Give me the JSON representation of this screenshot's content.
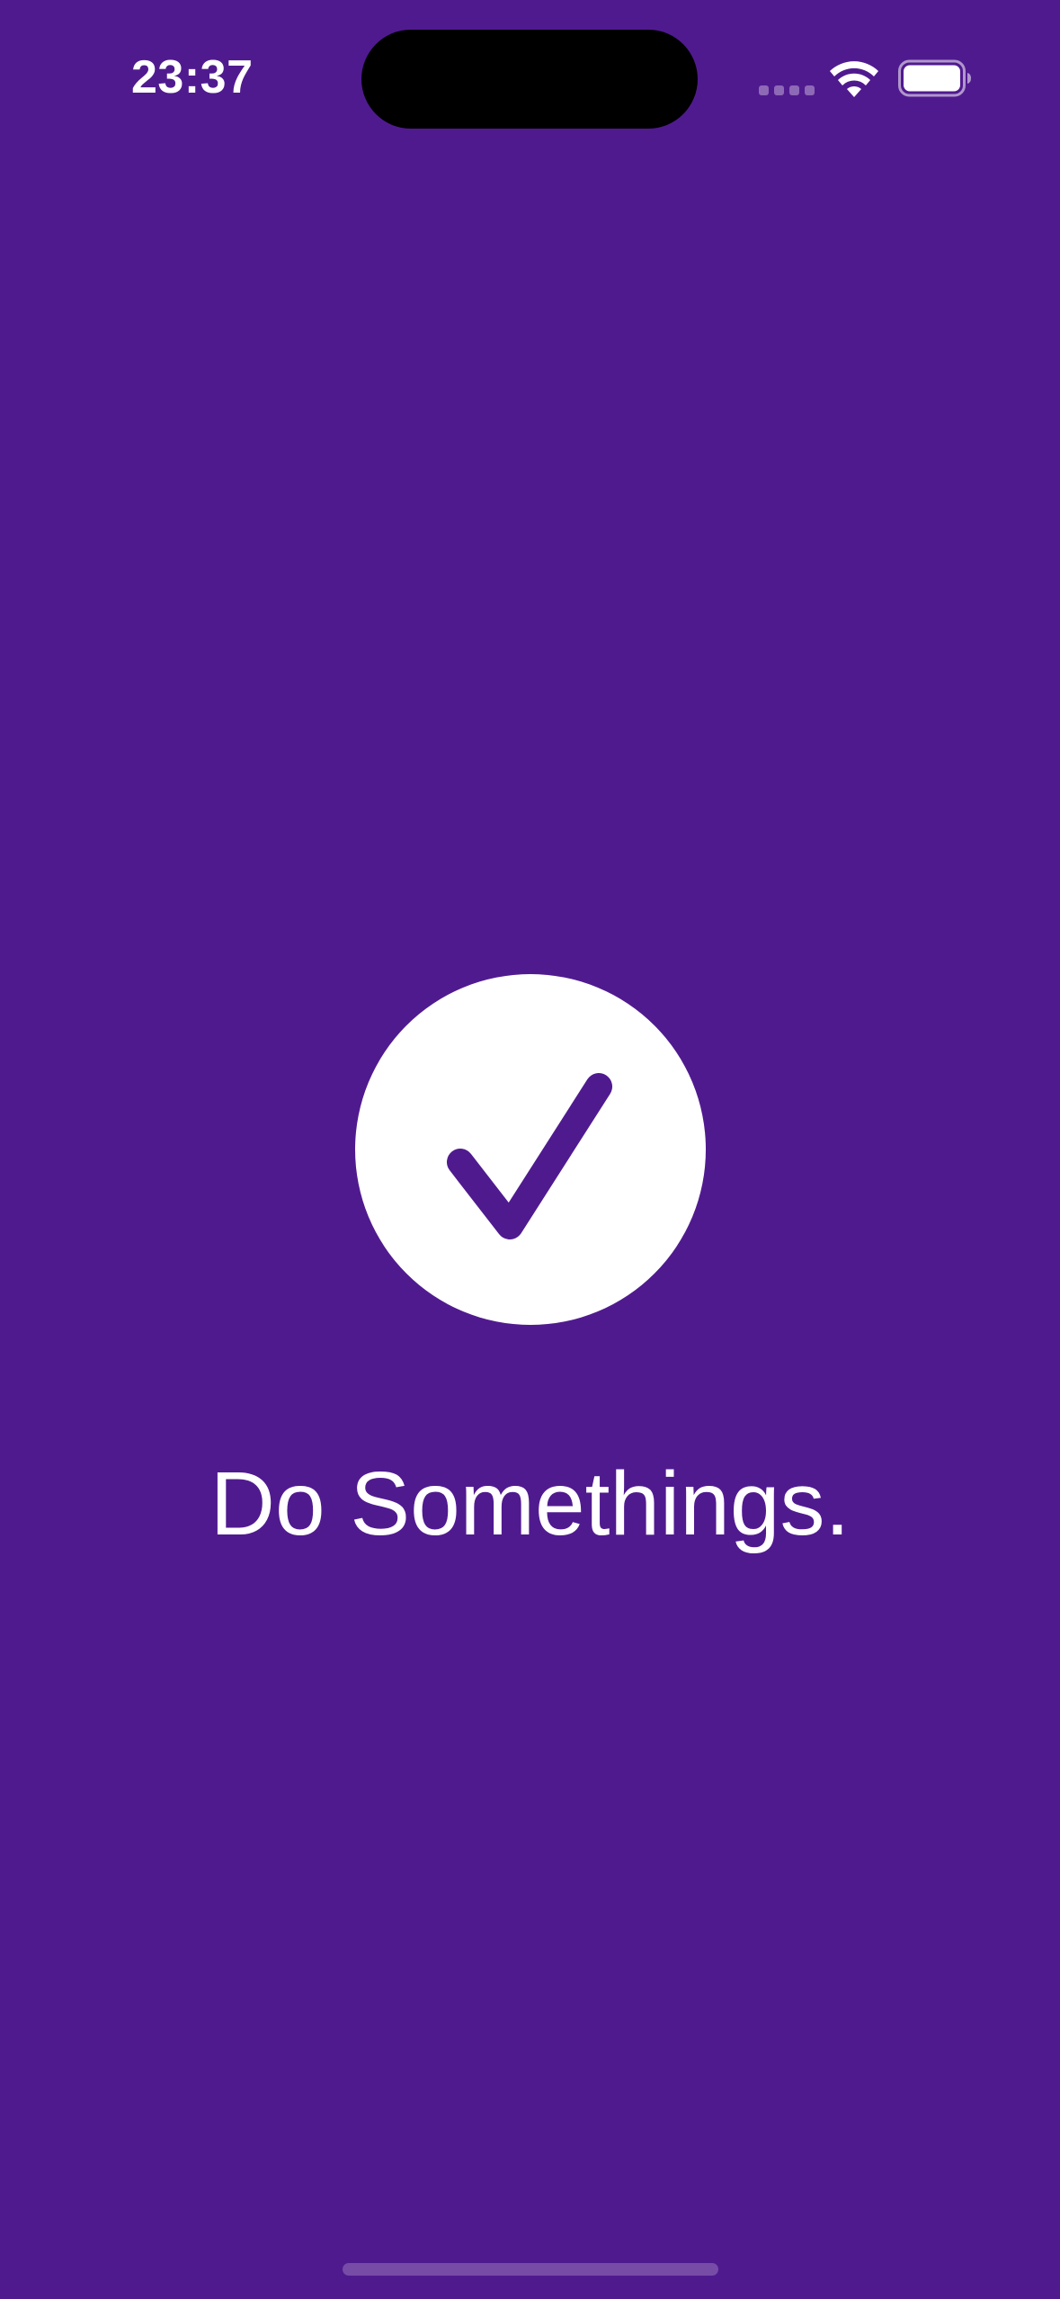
{
  "status_bar": {
    "time": "23:37",
    "signal_icon": "cellular-signal-icon",
    "wifi_icon": "wifi-icon",
    "battery_icon": "battery-icon"
  },
  "main": {
    "icon": "checkmark-circle-icon",
    "headline": "Do Somethings."
  },
  "colors": {
    "background": "#501a8f",
    "foreground": "#ffffff",
    "accent": "#501a8f"
  }
}
